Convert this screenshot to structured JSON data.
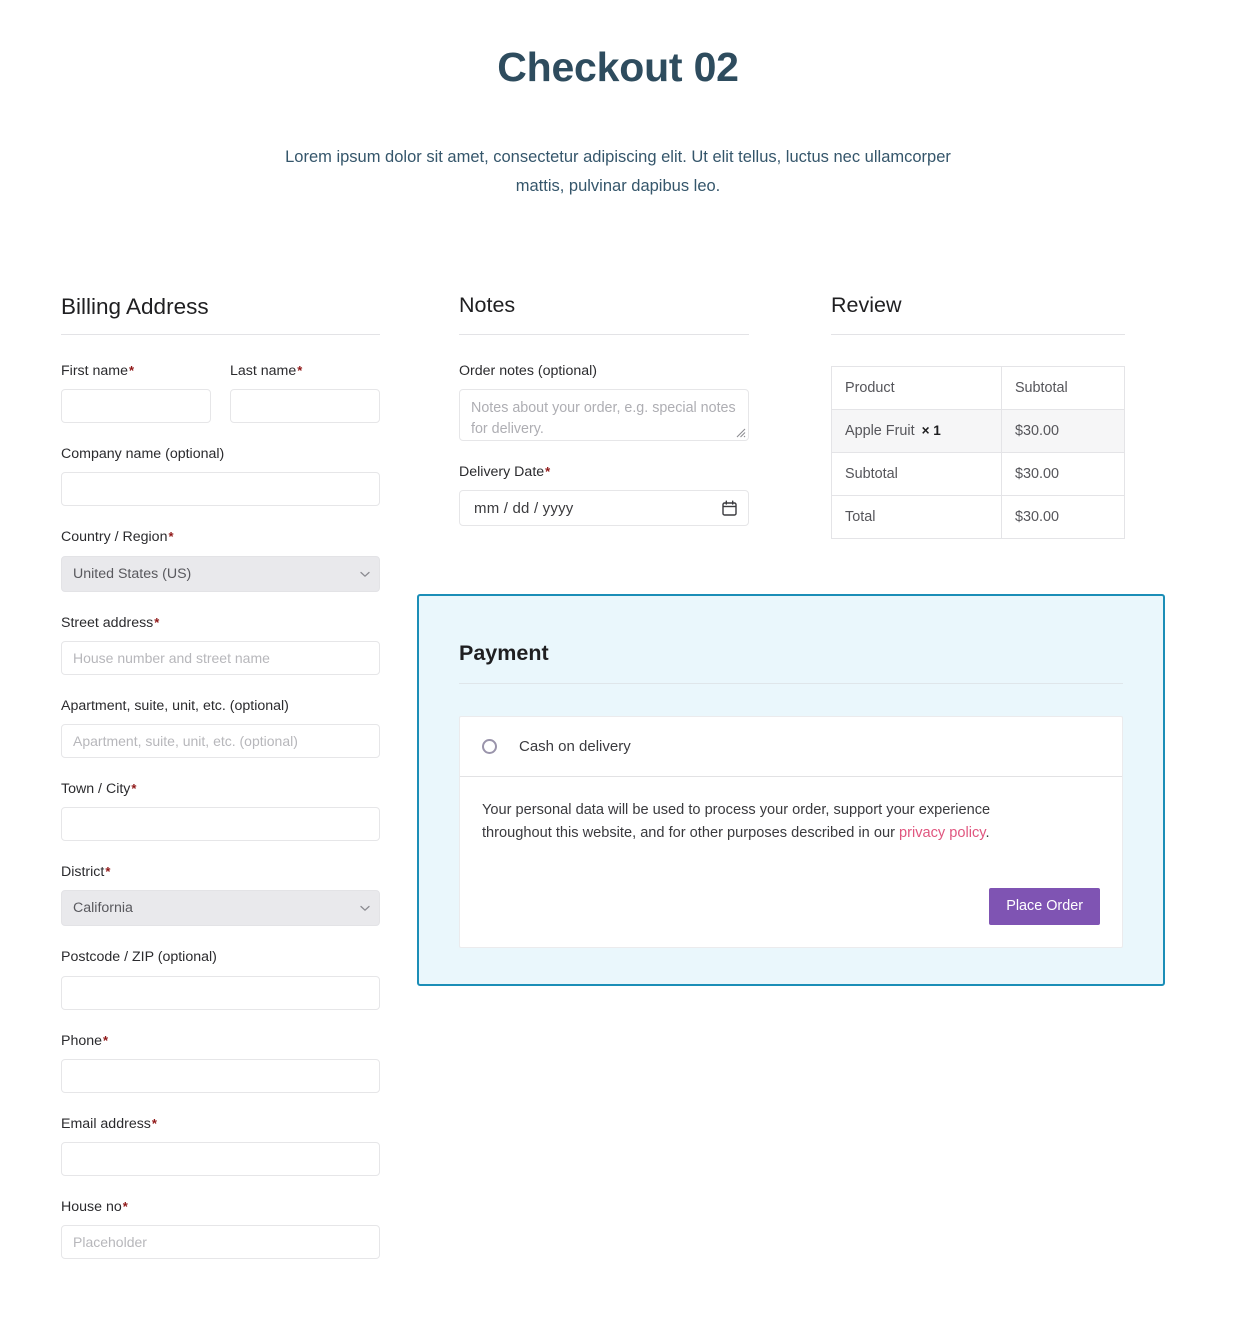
{
  "header": {
    "title": "Checkout 02",
    "subtitle": "Lorem ipsum dolor sit amet, consectetur adipiscing elit. Ut elit tellus, luctus nec ullamcorper mattis, pulvinar dapibus leo."
  },
  "billing": {
    "heading": "Billing Address",
    "fields": {
      "first_name": {
        "label": "First name",
        "required": "*",
        "value": "",
        "placeholder": ""
      },
      "last_name": {
        "label": "Last name",
        "required": "*",
        "value": "",
        "placeholder": ""
      },
      "company": {
        "label": "Company name (optional)",
        "value": "",
        "placeholder": ""
      },
      "country": {
        "label": "Country / Region",
        "required": "*",
        "value": "United States (US)"
      },
      "street": {
        "label": "Street address",
        "required": "*",
        "value": "",
        "placeholder": "House number and street name"
      },
      "apartment": {
        "label": "Apartment, suite, unit, etc. (optional)",
        "value": "",
        "placeholder": "Apartment, suite, unit, etc. (optional)"
      },
      "city": {
        "label": "Town / City",
        "required": "*",
        "value": "",
        "placeholder": ""
      },
      "district": {
        "label": "District",
        "required": "*",
        "value": "California"
      },
      "postcode": {
        "label": "Postcode / ZIP (optional)",
        "value": "",
        "placeholder": ""
      },
      "phone": {
        "label": "Phone",
        "required": "*",
        "value": "",
        "placeholder": ""
      },
      "email": {
        "label": "Email address",
        "required": "*",
        "value": "",
        "placeholder": ""
      },
      "house_no": {
        "label": "House no",
        "required": "*",
        "value": "",
        "placeholder": "Placeholder"
      }
    }
  },
  "notes": {
    "heading": "Notes",
    "order_notes": {
      "label": "Order notes (optional)",
      "value": "",
      "placeholder": "Notes about your order, e.g. special notes for delivery."
    },
    "delivery_date": {
      "label": "Delivery Date",
      "required": "*",
      "value": "mm / dd / yyyy"
    }
  },
  "review": {
    "heading": "Review",
    "columns": [
      "Product",
      "Subtotal"
    ],
    "rows": [
      {
        "label": "Apple Fruit",
        "quantity": "× 1",
        "amount": "$30.00",
        "type": "item"
      },
      {
        "label": "Subtotal",
        "quantity": "",
        "amount": "$30.00",
        "type": "subtotal"
      },
      {
        "label": "Total",
        "quantity": "",
        "amount": "$30.00",
        "type": "total"
      }
    ]
  },
  "payment": {
    "heading": "Payment",
    "methods": [
      {
        "label": "Cash on delivery",
        "selected": false
      }
    ],
    "privacy_text_before": "Your personal data will be used to process your order, support your experience throughout this website, and for other purposes described in our ",
    "privacy_link": "privacy policy",
    "privacy_text_after": ".",
    "place_order_label": "Place Order"
  },
  "colors": {
    "title": "#2e4c5e",
    "panel_border": "#1b8eb7",
    "panel_background": "#eaf7fc",
    "button": "#7f54b3",
    "link": "#e0567f",
    "required": "#8f1616"
  }
}
